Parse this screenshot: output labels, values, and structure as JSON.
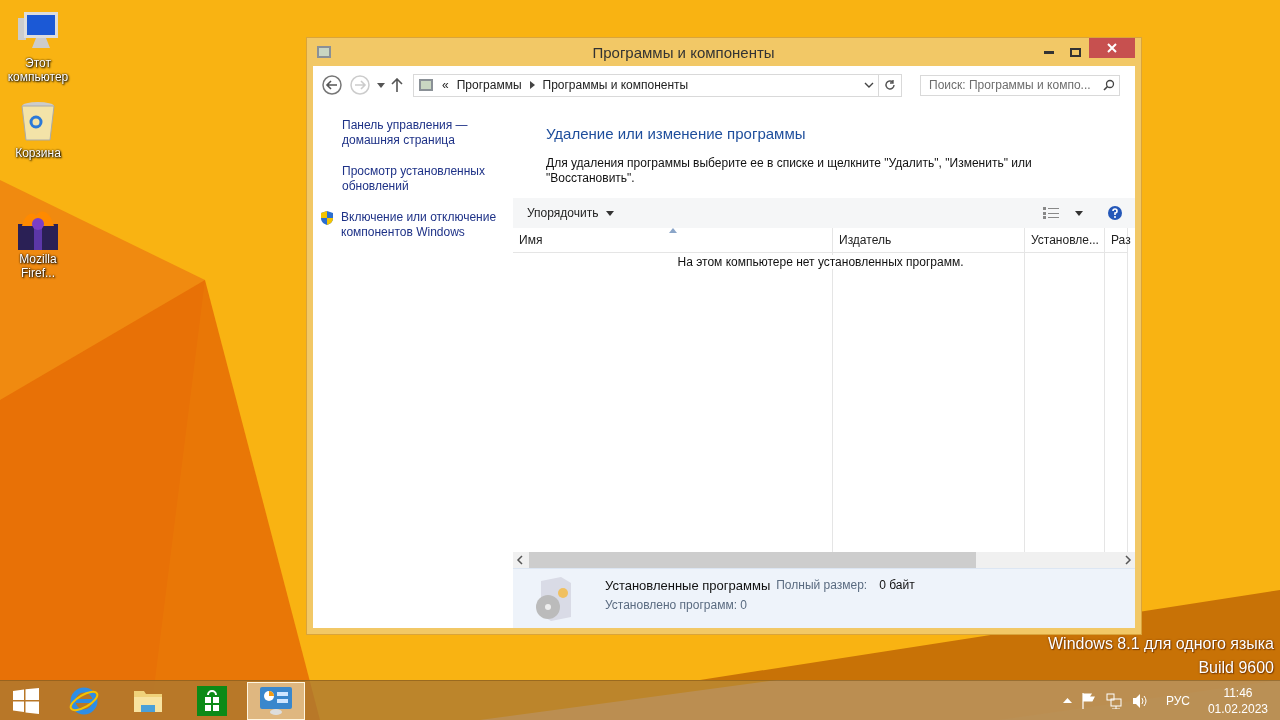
{
  "desktop_icons": [
    {
      "kind": "computer",
      "label": "Этот компьютер"
    },
    {
      "kind": "recycle",
      "label": "Корзина"
    },
    {
      "kind": "firefox",
      "label": "Mozilla Firef..."
    }
  ],
  "window": {
    "title": "Программы и компоненты",
    "address": {
      "overflow": "«",
      "breadcrumbs": [
        "Программы",
        "Программы и компоненты"
      ]
    },
    "search": {
      "placeholder": "Поиск: Программы и компо..."
    },
    "sidebar": [
      {
        "kind": "link",
        "text": "Панель управления — домашняя страница"
      },
      {
        "kind": "link",
        "text": "Просмотр установленных обновлений"
      },
      {
        "kind": "shield",
        "text": "Включение или отключение компонентов Windows"
      }
    ],
    "heading": "Удаление или изменение программы",
    "description": "Для удаления программы выберите ее в списке и щелкните \"Удалить\", \"Изменить\" или \"Восстановить\".",
    "organize": "Упорядочить",
    "columns": [
      {
        "label": "Имя",
        "sorted": true
      },
      {
        "label": "Издатель",
        "sorted": false
      },
      {
        "label": "Установле...",
        "sorted": false
      },
      {
        "label": "Раз",
        "sorted": false
      }
    ],
    "empty_message": "На этом компьютере нет установленных программ.",
    "details": {
      "title": "Установленные программы",
      "size_label": "Полный размер:",
      "size_value": "0 байт",
      "count": "Установлено программ: 0"
    }
  },
  "os_edition": [
    "Windows 8.1 для одного языка",
    "Build 9600"
  ],
  "taskbar": {
    "apps": [
      {
        "kind": "ie",
        "selected": false
      },
      {
        "kind": "explorer",
        "selected": false
      },
      {
        "kind": "store",
        "selected": false
      },
      {
        "kind": "control_panel",
        "selected": true
      }
    ],
    "language": "РУС",
    "time": "11:46",
    "date": "01.02.2023"
  }
}
